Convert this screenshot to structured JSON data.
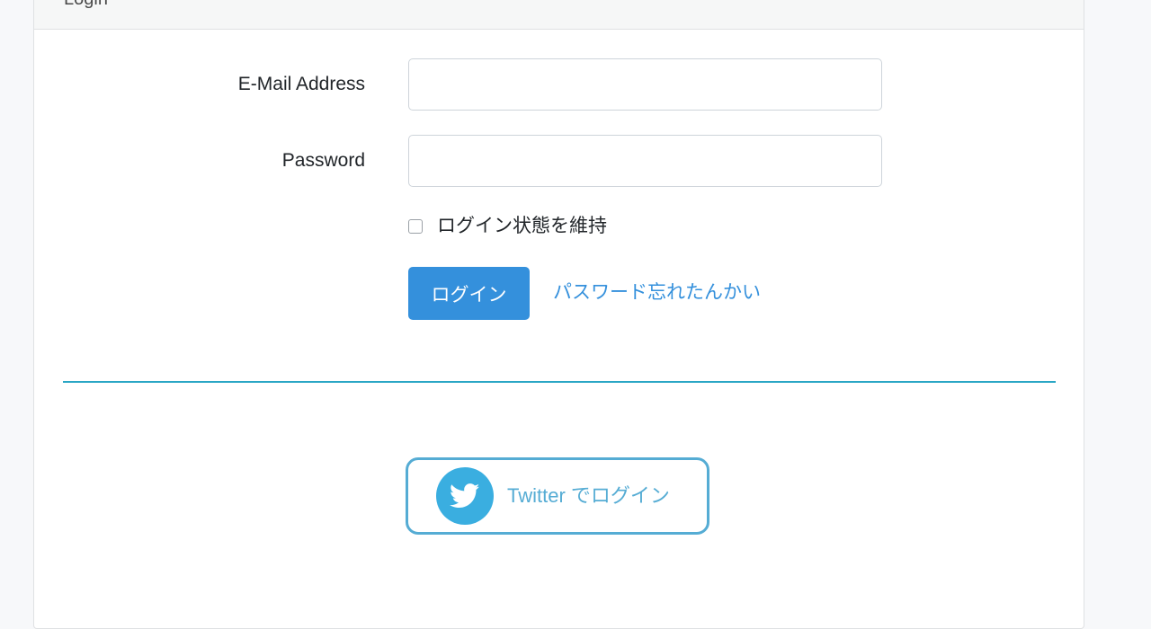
{
  "card": {
    "header_title": "Login"
  },
  "form": {
    "email": {
      "label": "E-Mail Address",
      "value": "",
      "placeholder": ""
    },
    "password": {
      "label": "Password",
      "value": "",
      "placeholder": ""
    },
    "remember": {
      "label": "ログイン状態を維持",
      "checked": false
    },
    "submit_label": "ログイン",
    "forgot_label": "パスワード忘れたんかい"
  },
  "social": {
    "twitter_label": "Twitter でログイン",
    "icon": "twitter-bird-icon"
  },
  "colors": {
    "primary": "#3490dc",
    "twitter": "#3aaee0",
    "twitter_text": "#55acd4",
    "divider": "#2aa6c5"
  }
}
